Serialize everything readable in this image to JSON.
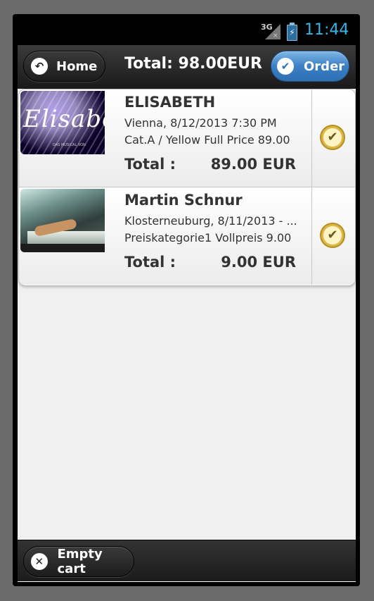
{
  "status": {
    "network": "3G",
    "time": "11:44"
  },
  "header": {
    "home_label": "Home",
    "title": "Total: 98.00EUR",
    "order_label": "Order"
  },
  "items": [
    {
      "title": "ELISABETH",
      "line1": "Vienna, 8/12/2013 7:30 PM",
      "line2": "Cat.A / Yellow Full Price 89.00",
      "total_label": "Total :",
      "total_value": "89.00 EUR",
      "thumb_text": "Elisabeth",
      "thumb_small": "DAS MUSICAL VON"
    },
    {
      "title": "Martin Schnur",
      "line1": "Klosterneuburg, 8/11/2013 - ...",
      "line2": "Preiskategorie1 Vollpreis  9.00",
      "total_label": "Total :",
      "total_value": "9.00 EUR"
    }
  ],
  "footer": {
    "empty_label": "Empty cart"
  },
  "colors": {
    "accent": "#3b7fc4",
    "clock": "#33b5e5",
    "check": "#d9b03c"
  }
}
